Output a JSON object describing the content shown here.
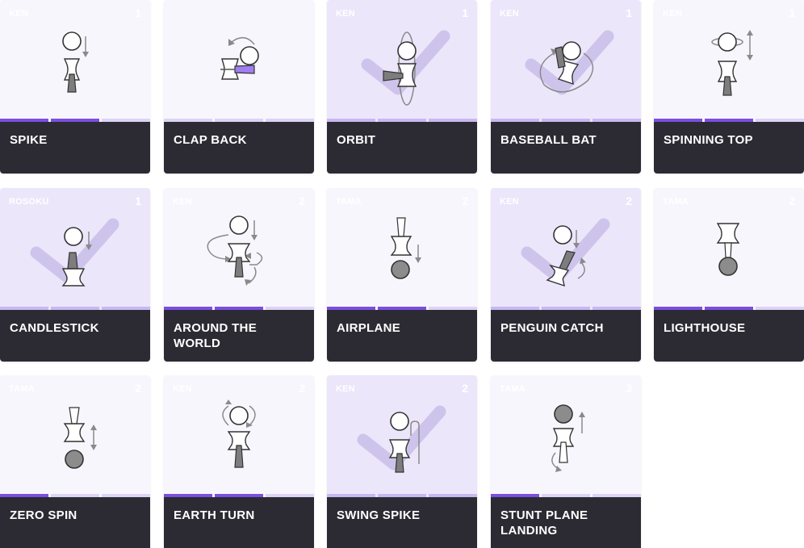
{
  "tricks": [
    {
      "name": "SPIKE",
      "category": "KEN",
      "count": "1",
      "done": false,
      "progress": [
        true,
        true,
        false
      ]
    },
    {
      "name": "CLAP BACK",
      "category": "",
      "count": "",
      "done": false,
      "progress": [
        false,
        false,
        false
      ]
    },
    {
      "name": "ORBIT",
      "category": "KEN",
      "count": "1",
      "done": true,
      "progress": [
        false,
        false,
        false
      ]
    },
    {
      "name": "BASEBALL BAT",
      "category": "KEN",
      "count": "1",
      "done": true,
      "progress": [
        false,
        false,
        false
      ]
    },
    {
      "name": "SPINNING TOP",
      "category": "KEN",
      "count": "1",
      "done": false,
      "progress": [
        true,
        true,
        false
      ]
    },
    {
      "name": "CANDLESTICK",
      "category": "ROSOKU",
      "count": "1",
      "done": true,
      "progress": [
        false,
        false,
        false
      ]
    },
    {
      "name": "AROUND THE WORLD",
      "category": "KEN",
      "count": "2",
      "done": false,
      "progress": [
        true,
        true,
        false
      ]
    },
    {
      "name": "AIRPLANE",
      "category": "TAMA",
      "count": "2",
      "done": false,
      "progress": [
        true,
        true,
        false
      ]
    },
    {
      "name": "PENGUIN CATCH",
      "category": "KEN",
      "count": "2",
      "done": true,
      "progress": [
        false,
        false,
        false
      ]
    },
    {
      "name": "LIGHTHOUSE",
      "category": "TAMA",
      "count": "2",
      "done": false,
      "progress": [
        true,
        true,
        false
      ]
    },
    {
      "name": "ZERO SPIN",
      "category": "TAMA",
      "count": "2",
      "done": false,
      "progress": [
        true,
        false,
        false
      ]
    },
    {
      "name": "EARTH TURN",
      "category": "KEN",
      "count": "2",
      "done": false,
      "progress": [
        true,
        true,
        false
      ]
    },
    {
      "name": "SWING SPIKE",
      "category": "KEN",
      "count": "2",
      "done": true,
      "progress": [
        false,
        false,
        false
      ]
    },
    {
      "name": "STUNT PLANE LANDING",
      "category": "TAMA",
      "count": "3",
      "done": false,
      "progress": [
        true,
        false,
        false
      ]
    }
  ],
  "colors": {
    "accent": "#7b4fe0",
    "label_bg": "#2c2b33",
    "card_bg": "#f8f6fd",
    "card_done_bg": "#ece6fb"
  }
}
